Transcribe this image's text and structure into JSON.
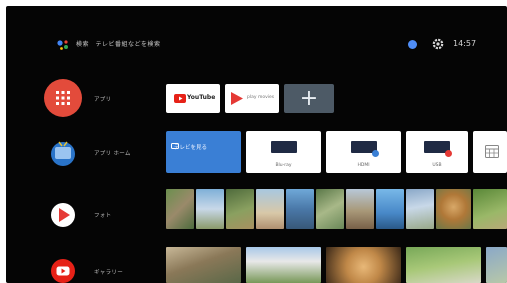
{
  "header": {
    "search_text": "検索　テレビ番組などを検索",
    "clock": "14:57",
    "assistant_icon": "google-assistant-icon",
    "settings_icon": "gear-icon"
  },
  "rows": [
    {
      "label": "アプリ",
      "icon": "apps-grid-icon",
      "color": "#e34b3b"
    },
    {
      "label": "アプリ ホーム",
      "icon": "tv-input-icon",
      "color": "#2a74c9"
    },
    {
      "label": "フォト",
      "icon": "play-movies-icon",
      "color": "#e53935"
    },
    {
      "label": "ギャラリー",
      "icon": "youtube-icon",
      "color": "#e62117"
    }
  ],
  "apps": [
    {
      "label": "YouTube",
      "icon": "youtube-logo-icon"
    },
    {
      "label": "play movies",
      "icon": "play-movies-logo-icon"
    }
  ],
  "add_tile_label": "+",
  "inputs": [
    {
      "label": "テレビを見る",
      "active": true
    },
    {
      "label": "Blu-ray",
      "active": false
    },
    {
      "label": "HDMI",
      "active": false
    },
    {
      "label": "USB",
      "active": false
    }
  ],
  "colors": {
    "background": "#050505",
    "accent_blue": "#3a7fd5",
    "profile_blue": "#4f8ef7",
    "apps_red": "#e34b3b"
  }
}
